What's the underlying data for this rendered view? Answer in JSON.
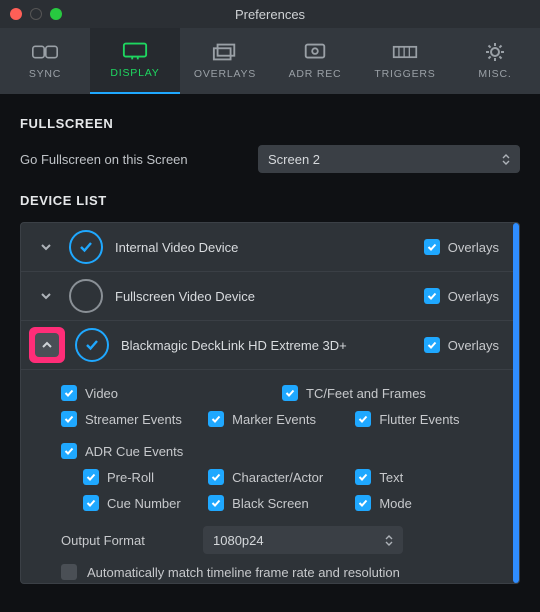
{
  "window": {
    "title": "Preferences"
  },
  "tabs": {
    "sync": "SYNC",
    "display": "DISPLAY",
    "overlays": "OVERLAYS",
    "adrrec": "ADR REC",
    "triggers": "TRIGGERS",
    "misc": "MISC."
  },
  "fullscreen": {
    "heading": "FULLSCREEN",
    "label": "Go Fullscreen on this Screen",
    "selected": "Screen 2"
  },
  "devicelist": {
    "heading": "DEVICE LIST",
    "overlays_label": "Overlays",
    "devices": [
      {
        "name": "Internal Video Device"
      },
      {
        "name": "Fullscreen Video Device"
      },
      {
        "name": "Blackmagic DeckLink HD Extreme 3D+"
      }
    ],
    "options": {
      "video": "Video",
      "tcfeet": "TC/Feet and Frames",
      "streamer": "Streamer Events",
      "marker": "Marker Events",
      "flutter": "Flutter Events",
      "adrcue": "ADR Cue Events",
      "preroll": "Pre-Roll",
      "charact": "Character/Actor",
      "text": "Text",
      "cuenum": "Cue Number",
      "black": "Black Screen",
      "mode": "Mode"
    },
    "output": {
      "label": "Output Format",
      "value": "1080p24",
      "auto": "Automatically match timeline frame rate and resolution"
    }
  }
}
